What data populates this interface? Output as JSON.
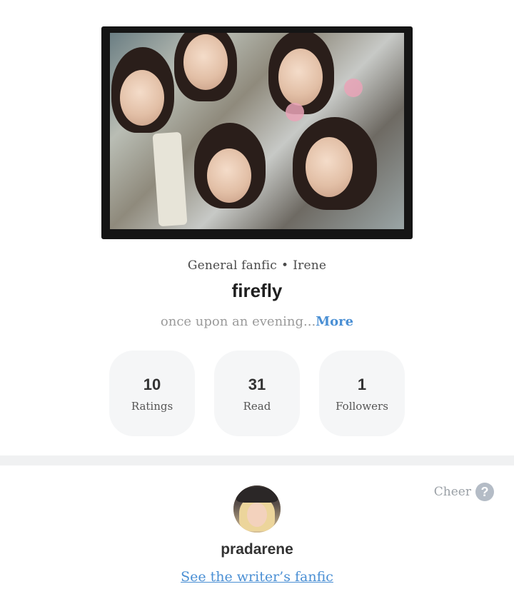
{
  "story": {
    "genre": "General fanfic",
    "separator": "•",
    "tag": "Irene",
    "title": "firefly",
    "description": "once upon an evening...",
    "more_label": "More"
  },
  "stats": [
    {
      "value": "10",
      "label": "Ratings"
    },
    {
      "value": "31",
      "label": "Read"
    },
    {
      "value": "1",
      "label": "Followers"
    }
  ],
  "writer": {
    "cheer_label": "Cheer",
    "help_glyph": "?",
    "name": "pradarene",
    "link_label": "See the writer’s fanfic"
  },
  "colors": {
    "accent": "#4a8fd4",
    "stat_bg": "#f5f6f7",
    "divider": "#f0f1f2"
  }
}
